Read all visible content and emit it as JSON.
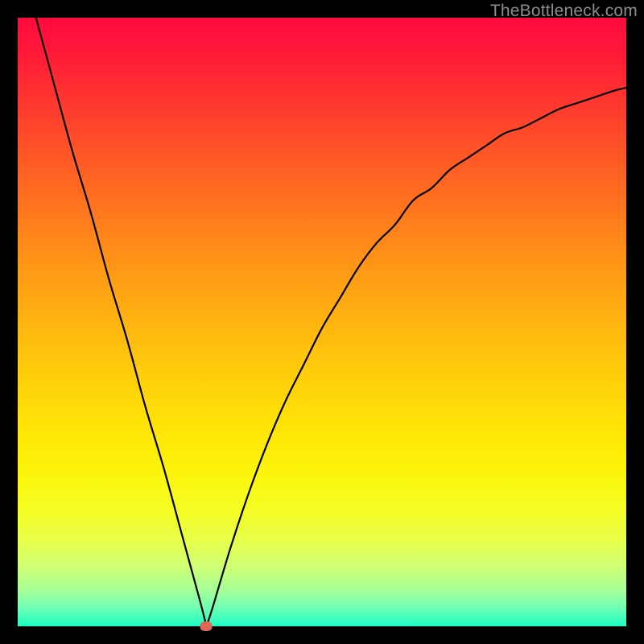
{
  "header": {
    "watermark": "TheBottleneck.com"
  },
  "colors": {
    "background": "#000000",
    "curve_stroke": "#000000",
    "marker_fill": "#e1665a",
    "gradient_stops": [
      {
        "pct": 0,
        "hex": "#ff0b3e"
      },
      {
        "pct": 5,
        "hex": "#ff1739"
      },
      {
        "pct": 12,
        "hex": "#ff3131"
      },
      {
        "pct": 20,
        "hex": "#ff4e29"
      },
      {
        "pct": 28,
        "hex": "#ff6a21"
      },
      {
        "pct": 36,
        "hex": "#ff861a"
      },
      {
        "pct": 44,
        "hex": "#ffa114"
      },
      {
        "pct": 52,
        "hex": "#ffba0f"
      },
      {
        "pct": 60,
        "hex": "#ffd10a"
      },
      {
        "pct": 68,
        "hex": "#ffe607"
      },
      {
        "pct": 74,
        "hex": "#fcf30a"
      },
      {
        "pct": 78,
        "hex": "#f8fa16"
      },
      {
        "pct": 82,
        "hex": "#f2fd2b"
      },
      {
        "pct": 86,
        "hex": "#e7ff4a"
      },
      {
        "pct": 90,
        "hex": "#cfff72"
      },
      {
        "pct": 94,
        "hex": "#a6ff96"
      },
      {
        "pct": 97,
        "hex": "#6fffb5"
      },
      {
        "pct": 100,
        "hex": "#1bffc3"
      }
    ]
  },
  "chart_data": {
    "type": "line",
    "title": "",
    "xlabel": "",
    "ylabel": "",
    "xlim": [
      0,
      100
    ],
    "ylim": [
      0,
      100
    ],
    "grid": false,
    "minimum": {
      "x": 31,
      "y": 0
    },
    "series": [
      {
        "name": "bottleneck-curve",
        "x": [
          3,
          6,
          9,
          12,
          15,
          18,
          21,
          24,
          27,
          30,
          31,
          32,
          35,
          38,
          41,
          44,
          47,
          50,
          53,
          56,
          59,
          62,
          65,
          68,
          71,
          74,
          77,
          80,
          83,
          86,
          89,
          92,
          95,
          98,
          100
        ],
        "values": [
          100,
          89,
          78,
          68,
          57,
          47,
          36,
          26,
          15,
          4,
          0,
          3,
          13,
          22,
          30,
          37,
          43,
          49,
          54,
          59,
          63,
          66,
          70,
          72,
          75,
          77,
          79,
          81,
          82,
          83.5,
          85,
          86,
          87,
          88,
          88.5
        ]
      }
    ],
    "marker": {
      "x": 31,
      "y": 0
    }
  }
}
